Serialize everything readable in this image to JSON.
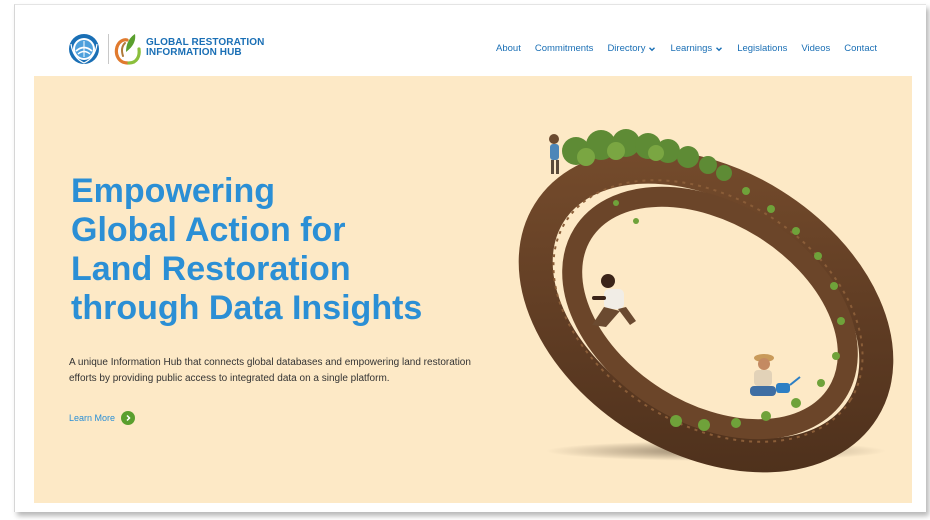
{
  "brand": {
    "line1": "GLOBAL RESTORATION",
    "line2": "INFORMATION HUB"
  },
  "nav": {
    "about": "About",
    "commitments": "Commitments",
    "directory": "Directory",
    "learnings": "Learnings",
    "legislations": "Legislations",
    "videos": "Videos",
    "contact": "Contact"
  },
  "hero": {
    "l1": "Empowering",
    "l2a": "Global Action",
    "l2b": " for",
    "l3a": "Land ",
    "l3b": "Restoration",
    "l4a": "through ",
    "l4b": "Data Insights",
    "description": "A unique Information Hub that connects global databases and empowering land restoration efforts by providing public access to integrated data on a single platform.",
    "cta": "Learn More"
  },
  "colors": {
    "primary": "#2b8fd5",
    "nav": "#1a6fb5",
    "hero_bg": "#fde9c6",
    "cta_green": "#5a9f2e",
    "soil": "#5c3a22"
  },
  "icons": {
    "un_logo": "un-emblem-icon",
    "hub_logo": "grih-leaf-icon",
    "dropdown": "chevron-down-icon",
    "cta": "arrow-right-icon"
  }
}
